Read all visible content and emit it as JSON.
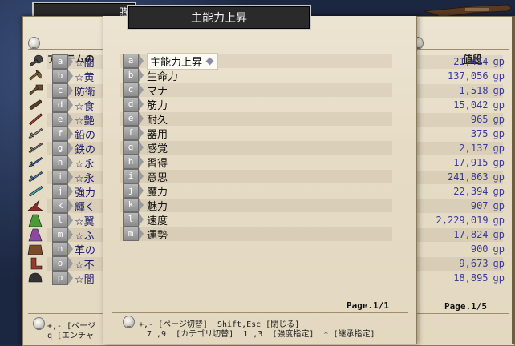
{
  "back_panel": {
    "tab_title": "購",
    "header_left": "アイテムの",
    "header_right": "値段",
    "items": [
      {
        "key": "a",
        "name": "☆闇",
        "price": "21,414",
        "icon": "mace-icon",
        "color": "#444"
      },
      {
        "key": "b",
        "name": "☆黄",
        "price": "137,056",
        "icon": "axe-icon",
        "color": "#7a5c2e"
      },
      {
        "key": "c",
        "name": "防衛",
        "price": "1,518",
        "icon": "hammer-icon",
        "color": "#6b4b2a"
      },
      {
        "key": "d",
        "name": "☆食",
        "price": "15,042",
        "icon": "club-icon",
        "color": "#5a3b24"
      },
      {
        "key": "e",
        "name": "☆艶",
        "price": "965",
        "icon": "red-sword-icon",
        "color": "#a33"
      },
      {
        "key": "f",
        "name": "鉛の",
        "price": "375",
        "icon": "sword-icon",
        "color": "#888"
      },
      {
        "key": "g",
        "name": "鉄の",
        "price": "2,137",
        "icon": "sword-icon",
        "color": "#777"
      },
      {
        "key": "h",
        "name": "☆永",
        "price": "17,915",
        "icon": "blue-sword-icon",
        "color": "#3a6aa0"
      },
      {
        "key": "i",
        "name": "☆永",
        "price": "241,863",
        "icon": "blue-sword-icon",
        "color": "#4a7ab0"
      },
      {
        "key": "j",
        "name": "強力",
        "price": "22,394",
        "icon": "cyan-sword-icon",
        "color": "#3aa0a8"
      },
      {
        "key": "k",
        "name": "輝く",
        "price": "907",
        "icon": "witch-hat-icon",
        "color": "#8a2a2a"
      },
      {
        "key": "l",
        "name": "☆翼",
        "price": "2,229,019",
        "icon": "green-robe-icon",
        "color": "#4a9a3a"
      },
      {
        "key": "m",
        "name": "☆ふ",
        "price": "17,824",
        "icon": "purple-robe-icon",
        "color": "#8a4aa0"
      },
      {
        "key": "n",
        "name": "革の",
        "price": "900",
        "icon": "leather-armor-icon",
        "color": "#7a4a2a"
      },
      {
        "key": "o",
        "name": "☆不",
        "price": "9,673",
        "icon": "boots-icon",
        "color": "#9a3a2a"
      },
      {
        "key": "p",
        "name": "☆闇",
        "price": "18,895",
        "icon": "helmet-icon",
        "color": "#333"
      }
    ],
    "currency": "gp",
    "page": "Page.1/5",
    "hint_line1": "+,- [ページ",
    "hint_line2": "q [エンチャ"
  },
  "front_panel": {
    "tab_title": "主能力上昇",
    "items": [
      {
        "key": "a",
        "name": "主能力上昇"
      },
      {
        "key": "b",
        "name": "生命力"
      },
      {
        "key": "c",
        "name": "マナ"
      },
      {
        "key": "d",
        "name": "筋力"
      },
      {
        "key": "e",
        "name": "耐久"
      },
      {
        "key": "f",
        "name": "器用"
      },
      {
        "key": "g",
        "name": "感覚"
      },
      {
        "key": "h",
        "name": "習得"
      },
      {
        "key": "i",
        "name": "意思"
      },
      {
        "key": "j",
        "name": "魔力"
      },
      {
        "key": "k",
        "name": "魅力"
      },
      {
        "key": "l",
        "name": "速度"
      },
      {
        "key": "m",
        "name": "運勢"
      }
    ],
    "selected_index": 0,
    "page": "Page.1/1",
    "hint_line1": "+,- [ページ切替]  Shift,Esc [閉じる]",
    "hint_line2": "7 ,9  [カテゴリ切替]  1 ,3  [強度指定]  * [継承指定]"
  }
}
